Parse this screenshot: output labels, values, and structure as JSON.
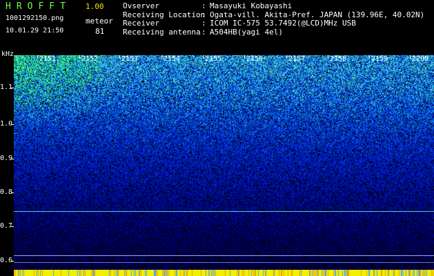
{
  "header": {
    "app_title": "HROFFT",
    "app_version": "1.00",
    "filename": "1001292150.png",
    "meteor_label": "meteor",
    "meteor_count": "81",
    "timestamp": "10.01.29 21:50",
    "info": [
      {
        "key": "Ovserver",
        "value": "Masayuki Kobayashi"
      },
      {
        "key": "Receiving Location",
        "value": "Ogata-vill. Akita-Pref. JAPAN (139.96E, 40.02N)"
      },
      {
        "key": "Receiver",
        "value": "ICOM IC-575 53.7492(@LCD)MHz USB"
      },
      {
        "key": "Receiving antenna",
        "value": "A504HB(yagi 4el)"
      }
    ],
    "separator": ":"
  },
  "axes": {
    "y_unit": "kHz",
    "y_ticks": [
      "1.1",
      "1.0",
      "0.9",
      "0.8",
      "0.7",
      "0.6"
    ],
    "x_ticks": [
      "2151",
      "2152",
      "2153",
      "2154",
      "2155",
      "2156",
      "2157",
      "2158",
      "2159",
      "2200"
    ]
  },
  "colors": {
    "background": "#000000",
    "title": "#6fff40",
    "version": "#f0e000",
    "text": "#ffffff",
    "signal_line": "#40d8d0",
    "ref_line": "#9aa8ff",
    "strip": "#f0f000"
  }
}
